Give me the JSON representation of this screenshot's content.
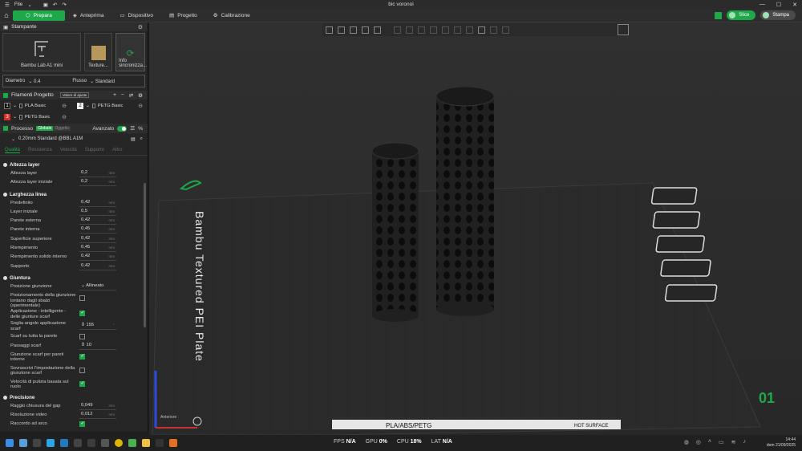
{
  "titlebar": {
    "file_label": "File",
    "title": "bic voronoi"
  },
  "menubar": {
    "tabs": [
      {
        "label": "Prepara",
        "active": true
      },
      {
        "label": "Anteprima"
      },
      {
        "label": "Dispositivo"
      },
      {
        "label": "Progetto"
      },
      {
        "label": "Calibrazione"
      }
    ],
    "slice_label": "Slice",
    "print_label": "Stampa"
  },
  "printer_section": {
    "title": "Stampante",
    "printer_name": "Bambu Lab A1 mini",
    "plate_label": "Texture...",
    "sync_label": "Info sincronizza...",
    "diameter_label": "Diametro",
    "diameter_value": "0.4",
    "flow_label": "Flusso",
    "flow_value": "Standard"
  },
  "filaments": {
    "title": "Filamenti Progetto",
    "badge": "Valore di ajuste",
    "items": [
      {
        "num": "1",
        "name": "PLA Basic",
        "color": "#111111"
      },
      {
        "num": "2",
        "name": "PETG Basic",
        "color": "#f2f2f2"
      },
      {
        "num": "3",
        "name": "PETG Basic",
        "color": "#d93025"
      }
    ]
  },
  "process": {
    "title": "Processo",
    "global_label": "Globale",
    "object_label": "Oggetto",
    "advanced_label": "Avanzato",
    "preset": "0.20mm Standard @BBL A1M",
    "tabs": [
      "Qualità",
      "Resistenza",
      "Velocità",
      "Supporto",
      "Altro"
    ]
  },
  "params": {
    "layer_height": {
      "title": "Altezza layer",
      "rows": [
        {
          "label": "Altezza layer",
          "value": "0,2",
          "unit": "mm"
        },
        {
          "label": "Altezza layer iniziale",
          "value": "0,2",
          "unit": "mm"
        }
      ]
    },
    "line_width": {
      "title": "Larghezza linea",
      "rows": [
        {
          "label": "Predefinito",
          "value": "0,42",
          "unit": "mm"
        },
        {
          "label": "Layer iniziale",
          "value": "0,5",
          "unit": "mm"
        },
        {
          "label": "Parete esterna",
          "value": "0,42",
          "unit": "mm"
        },
        {
          "label": "Parete interna",
          "value": "0,45",
          "unit": "mm"
        },
        {
          "label": "Superficie superiore",
          "value": "0,42",
          "unit": "mm"
        },
        {
          "label": "Riempimento",
          "value": "0,45",
          "unit": "mm"
        },
        {
          "label": "Riempimento solido interno",
          "value": "0,42",
          "unit": "mm"
        },
        {
          "label": "Supporto",
          "value": "0,42",
          "unit": "mm"
        }
      ]
    },
    "seam": {
      "title": "Giuntura",
      "position_label": "Posizione giunzione",
      "position_value": "Allineato",
      "rows": [
        {
          "label": "Posizionamento della giunzione lontano dagli sbalzi (sperimentale)",
          "checked": false
        },
        {
          "label": "Applicazione - intelligente - delle giunture scarf",
          "checked": true
        }
      ],
      "slope_label": "Soglia angolo applicazione scarf",
      "slope_value": "155",
      "slope_unit": "°",
      "whole_wall_label": "Scarf su tutta la parete",
      "steps_label": "Passaggi scarf",
      "steps_value": "10",
      "rows2": [
        {
          "label": "Giunzione scarf per pareti interne",
          "checked": true
        },
        {
          "label": "Sovrascrivi l'impostazione della giunzione scarf",
          "checked": false
        },
        {
          "label": "Velocità di pulizia basata sul ruolo",
          "checked": true
        }
      ]
    },
    "precision": {
      "title": "Precisione",
      "rows": [
        {
          "label": "Raggio chiusura del gap",
          "value": "0,049",
          "unit": "mm"
        },
        {
          "label": "Risoluzione video",
          "value": "0,012",
          "unit": "mm"
        }
      ],
      "arc_label": "Raccordo ad arco"
    }
  },
  "viewport": {
    "plate_label": "Bambu Textured PEI Plate",
    "plate_number": "01",
    "filament_label": "PLA/ABS/PETG",
    "surface_label": "HOT SURFACE",
    "axis_label": "Anteriore"
  },
  "taskbar": {
    "fps_label": "FPS",
    "fps_value": "N/A",
    "gpu_label": "GPU",
    "gpu_value": "0%",
    "cpu_label": "CPU",
    "cpu_value": "18%",
    "lat_label": "LAT",
    "lat_value": "N/A",
    "time": "14:44",
    "date": "dom 21/09/2025"
  },
  "colors": {
    "accent": "#1fa84a",
    "background": "#1e1e1e",
    "panel": "#262626"
  }
}
